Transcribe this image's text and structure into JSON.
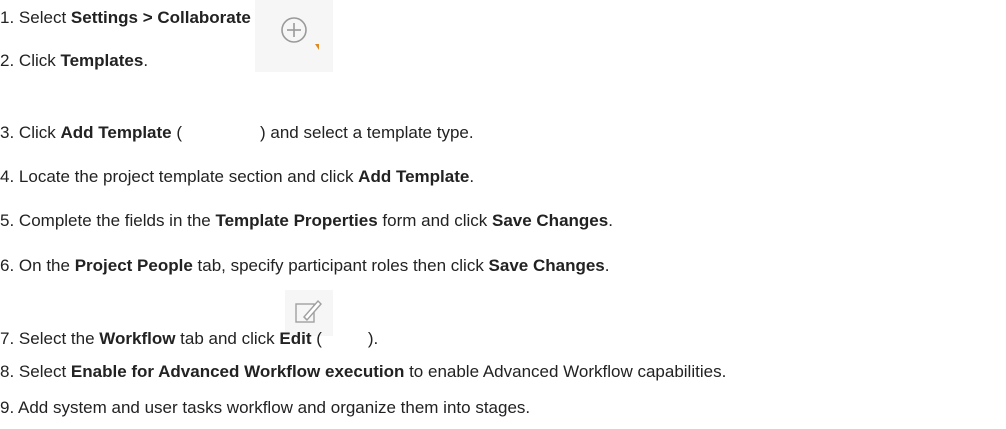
{
  "steps": [
    {
      "num": "1.",
      "pre": "Select ",
      "b1": "Settings > Collaborate Settings",
      "post": "."
    },
    {
      "num": "2.",
      "pre": "Click ",
      "b1": "Templates",
      "post": "."
    },
    {
      "num": "3.",
      "pre": "Click ",
      "b1": "Add Template",
      "mid": " (",
      "post": ") and select a template type.",
      "icon": "add-circle-icon"
    },
    {
      "num": "4.",
      "pre": "Locate the project template section and click ",
      "b1": "Add Template",
      "post": "."
    },
    {
      "num": "5.",
      "pre": "Complete the fields in the ",
      "b1": "Template Properties",
      "mid": " form and click ",
      "b2": "Save Changes",
      "post": "."
    },
    {
      "num": "6.",
      "pre": "On the ",
      "b1": "Project People",
      "mid": " tab, specify participant roles then click ",
      "b2": "Save Changes",
      "post": "."
    },
    {
      "num": "7.",
      "pre": "Select the ",
      "b1": "Workflow",
      "mid": " tab and click ",
      "b2": "Edit",
      "mid2": " (",
      "post": ").",
      "icon": "edit-icon"
    },
    {
      "num": "8.",
      "pre": "Select ",
      "b1": "Enable for Advanced Workflow execution",
      "post": " to enable Advanced Workflow capabilities."
    },
    {
      "num": "9.",
      "pre": "Add system and user tasks workflow and organize them into stages.",
      "post": ""
    }
  ]
}
